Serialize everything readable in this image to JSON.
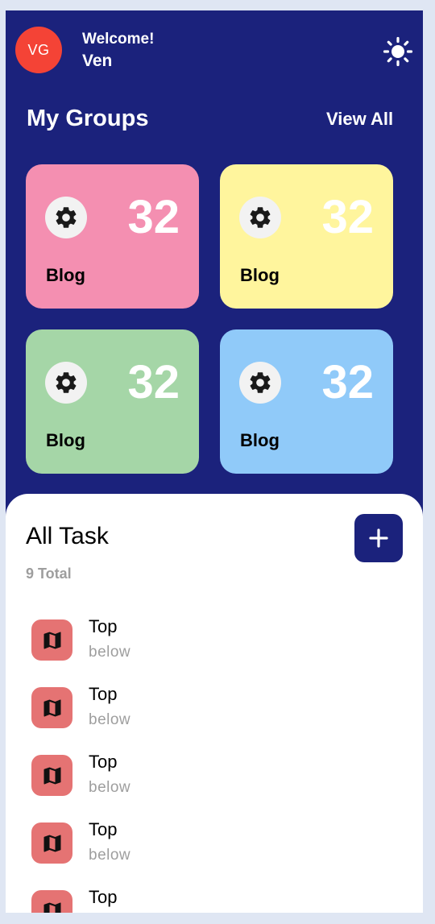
{
  "header": {
    "avatar_initials": "VG",
    "welcome_text": "Welcome!",
    "username": "Ven",
    "theme_icon": "sun-icon"
  },
  "groups": {
    "title": "My Groups",
    "view_all_label": "View All",
    "cards": [
      {
        "label": "Blog",
        "count": "32",
        "color": "#f48fb1",
        "icon": "gear-icon"
      },
      {
        "label": "Blog",
        "count": "32",
        "color": "#fff59d",
        "icon": "gear-icon"
      },
      {
        "label": "Blog",
        "count": "32",
        "color": "#a5d6a7",
        "icon": "gear-icon"
      },
      {
        "label": "Blog",
        "count": "32",
        "color": "#90caf9",
        "icon": "gear-icon"
      }
    ]
  },
  "tasks": {
    "title": "All Task",
    "total_label": "9 Total",
    "add_icon": "plus-icon",
    "items": [
      {
        "title": "Top",
        "subtitle": "below",
        "icon": "map-icon"
      },
      {
        "title": "Top",
        "subtitle": "below",
        "icon": "map-icon"
      },
      {
        "title": "Top",
        "subtitle": "below",
        "icon": "map-icon"
      },
      {
        "title": "Top",
        "subtitle": "below",
        "icon": "map-icon"
      },
      {
        "title": "Top",
        "subtitle": "",
        "icon": "map-icon"
      }
    ]
  },
  "colors": {
    "primary": "#1b227c",
    "avatar": "#f44336",
    "task_icon_bg": "#e57373",
    "muted_text": "#9e9e9e",
    "page_bg": "#dfe6f3"
  }
}
